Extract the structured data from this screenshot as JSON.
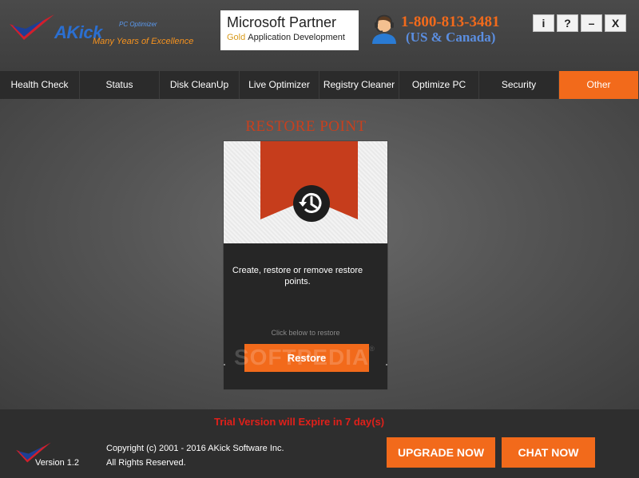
{
  "header": {
    "logo_name": "AKick",
    "logo_sub": "PC Optimizer",
    "logo_tagline": "Many Years of Excellence",
    "partner_title": "Microsoft Partner",
    "partner_gold": "Gold",
    "partner_subtitle": "Application Development",
    "phone": "1-800-813-3481",
    "region": "(US & Canada)",
    "window_buttons": {
      "info": "i",
      "help": "?",
      "minimize": "–",
      "close": "X"
    }
  },
  "nav": {
    "tabs": [
      {
        "label": "Health Check"
      },
      {
        "label": "Status"
      },
      {
        "label": "Disk CleanUp"
      },
      {
        "label": "Live Optimizer"
      },
      {
        "label": "Registry Cleaner"
      },
      {
        "label": "Optimize PC"
      },
      {
        "label": "Security"
      },
      {
        "label": "Other"
      }
    ],
    "active_tab": "Other"
  },
  "main": {
    "section_title": "RESTORE POINT",
    "card": {
      "description": "Create, restore or remove restore points.",
      "hint": "Click below to restore",
      "button_label": "Restore"
    },
    "watermark": "SOFTPEDIA",
    "watermark_mark": "®"
  },
  "footer": {
    "trial_text": "Trial Version will Expire in 7 day(s)",
    "version": "Version 1.2",
    "copyright_line1": "Copyright (c) 2001 - 2016 AKick Software Inc.",
    "copyright_line2": "All Rights Reserved.",
    "upgrade_label": "UPGRADE NOW",
    "chat_label": "CHAT NOW"
  },
  "colors": {
    "accent": "#f26a1b",
    "title_red": "#c8401e",
    "trial_red": "#e0201a",
    "logo_blue": "#2b6fd1"
  },
  "icons": {
    "logo": "akick-logo-icon",
    "support": "headset-agent-icon",
    "restore": "history-clock-icon"
  }
}
